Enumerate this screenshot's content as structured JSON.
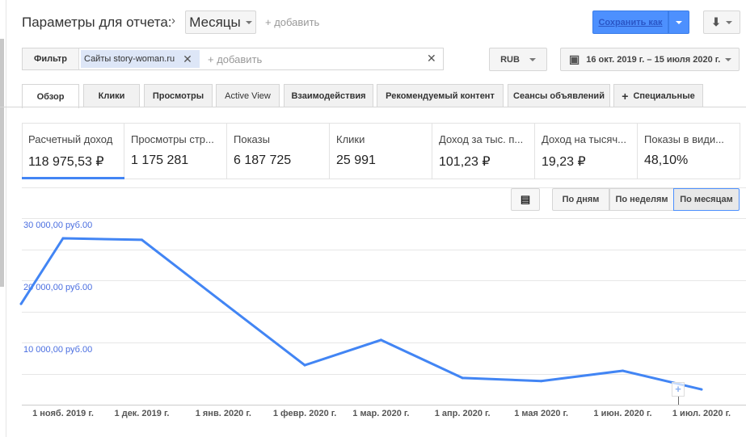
{
  "header": {
    "title": "Параметры для отчета:",
    "dimension": "Месяцы",
    "add_label": "+ добавить",
    "save_label": "Сохранить как"
  },
  "filter": {
    "label": "Фильтр",
    "chip": "Сайты story-woman.ru",
    "add_placeholder": "+ добавить",
    "currency": "RUB",
    "date_range": "16 окт. 2019 г. – 15 июля 2020 г."
  },
  "tabs": [
    {
      "label": "Обзор",
      "active": true
    },
    {
      "label": "Клики"
    },
    {
      "label": "Просмотры"
    },
    {
      "label": "Active View"
    },
    {
      "label": "Взаимодействия"
    },
    {
      "label": "Рекомендуемый контент"
    },
    {
      "label": "Сеансы объявлений"
    },
    {
      "label": "Специальные"
    }
  ],
  "metrics": [
    {
      "label": "Расчетный доход",
      "value": "118 975,53 ₽",
      "selected": true
    },
    {
      "label": "Просмотры стр...",
      "value": "1 175 281"
    },
    {
      "label": "Показы",
      "value": "6 187 725"
    },
    {
      "label": "Клики",
      "value": "25 991"
    },
    {
      "label": "Доход за тыс. п...",
      "value": "101,23 ₽"
    },
    {
      "label": "Доход на тысяч...",
      "value": "19,23 ₽"
    },
    {
      "label": "Показы в види...",
      "value": "48,10%"
    }
  ],
  "granularity": {
    "options": [
      "По дням",
      "По неделям",
      "По месяцам"
    ],
    "selected": "По месяцам"
  },
  "colors": {
    "accent": "#4285f4",
    "line": "#4285f4",
    "save_button": "#4d90fe"
  },
  "chart_data": {
    "type": "line",
    "ylim": [
      0,
      30000
    ],
    "y_ticks": [
      {
        "v": 10000,
        "label": "10 000,00 руб.00"
      },
      {
        "v": 20000,
        "label": "20 000,00 руб.00"
      },
      {
        "v": 30000,
        "label": "30 000,00 руб.00"
      }
    ],
    "x_ticks": [
      "1 нояб. 2019 г.",
      "1 дек. 2019 г.",
      "1 янв. 2020 г.",
      "1 февр. 2020 г.",
      "1 мар. 2020 г.",
      "1 апр. 2020 г.",
      "1 мая 2020 г.",
      "1 июн. 2020 г.",
      "1 июл. 2020 г."
    ],
    "x_tick_dates": [
      "2019-11-01",
      "2019-12-01",
      "2020-01-01",
      "2020-02-01",
      "2020-03-01",
      "2020-04-01",
      "2020-05-01",
      "2020-06-01",
      "2020-07-01"
    ],
    "grid": true,
    "points": [
      {
        "x": "2019-10-16",
        "y": 16200
      },
      {
        "x": "2019-11-01",
        "y": 26750
      },
      {
        "x": "2019-12-01",
        "y": 26500
      },
      {
        "x": "2020-01-01",
        "y": 16400
      },
      {
        "x": "2020-02-01",
        "y": 6350
      },
      {
        "x": "2020-03-01",
        "y": 10400
      },
      {
        "x": "2020-04-01",
        "y": 4300
      },
      {
        "x": "2020-05-01",
        "y": 3800
      },
      {
        "x": "2020-06-01",
        "y": 5450
      },
      {
        "x": "2020-07-01",
        "y": 2450
      }
    ]
  }
}
